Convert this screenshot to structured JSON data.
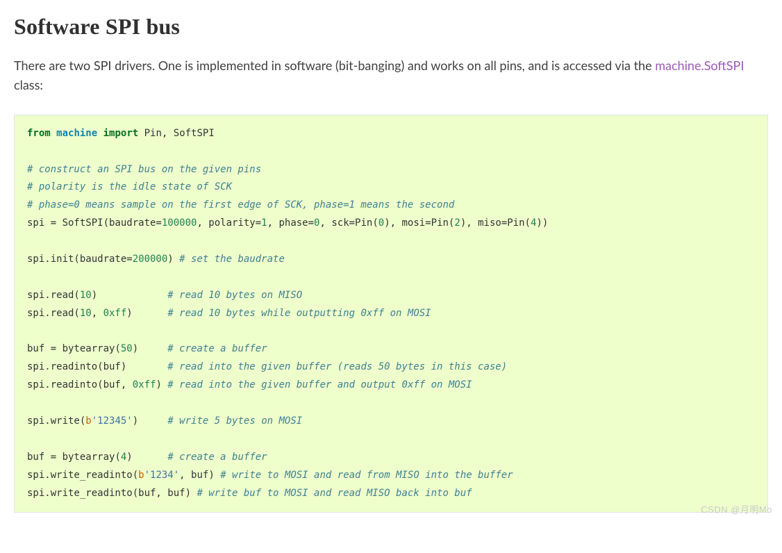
{
  "heading": "Software SPI bus",
  "intro": {
    "pre": "There are two SPI drivers. One is implemented in software (bit-banging) and works on all pins, and is accessed via the ",
    "link": "machine.SoftSPI",
    "post": " class:"
  },
  "code": {
    "from": "from",
    "module": "machine",
    "import": "import",
    "imports_rest": " Pin, SoftSPI",
    "c1": "# construct an SPI bus on the given pins",
    "c2": "# polarity is the idle state of SCK",
    "c3": "# phase=0 means sample on the first edge of SCK, phase=1 means the second",
    "l4a": "spi = SoftSPI(baudrate=",
    "l4n1": "100000",
    "l4b": ", polarity=",
    "l4n2": "1",
    "l4c": ", phase=",
    "l4n3": "0",
    "l4d": ", sck=Pin(",
    "l4n4": "0",
    "l4e": "), mosi=Pin(",
    "l4n5": "2",
    "l4f": "), miso=Pin(",
    "l4n6": "4",
    "l4g": "))",
    "l5a": "spi.init(baudrate=",
    "l5n": "200000",
    "l5b": ") ",
    "c5": "# set the baudrate",
    "l6a": "spi.read(",
    "l6n": "10",
    "l6b": ")            ",
    "c6": "# read 10 bytes on MISO",
    "l7a": "spi.read(",
    "l7n1": "10",
    "l7b": ", ",
    "l7n2": "0xff",
    "l7c": ")      ",
    "c7": "# read 10 bytes while outputting 0xff on MOSI",
    "l8a": "buf = bytearray(",
    "l8n": "50",
    "l8b": ")     ",
    "c8": "# create a buffer",
    "l9a": "spi.readinto(buf)       ",
    "c9": "# read into the given buffer (reads 50 bytes in this case)",
    "l10a": "spi.readinto(buf, ",
    "l10n": "0xff",
    "l10b": ") ",
    "c10": "# read into the given buffer and output 0xff on MOSI",
    "l11a": "spi.write(",
    "l11p": "b",
    "l11s": "'12345'",
    "l11b": ")     ",
    "c11": "# write 5 bytes on MOSI",
    "l12a": "buf = bytearray(",
    "l12n": "4",
    "l12b": ")      ",
    "c12": "# create a buffer",
    "l13a": "spi.write_readinto(",
    "l13p": "b",
    "l13s": "'1234'",
    "l13b": ", buf) ",
    "c13": "# write to MOSI and read from MISO into the buffer",
    "l14a": "spi.write_readinto(buf, buf) ",
    "c14": "# write buf to MOSI and read MISO back into buf"
  },
  "watermark": "CSDN @月明Mo"
}
